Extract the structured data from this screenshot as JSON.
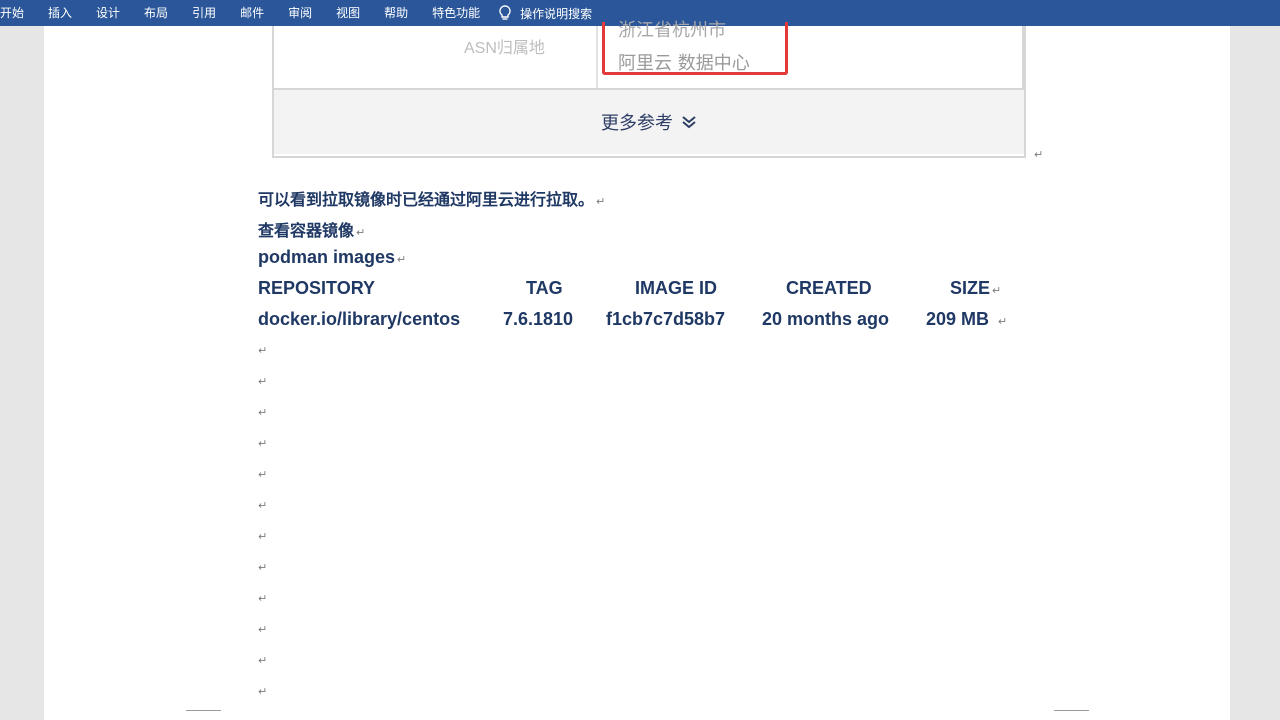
{
  "ribbon": {
    "tabs": [
      "开始",
      "插入",
      "设计",
      "布局",
      "引用",
      "邮件",
      "审阅",
      "视图",
      "帮助",
      "特色功能"
    ],
    "tell_me": "操作说明搜索"
  },
  "embed": {
    "asn_label": "ASN归属地",
    "highlight_line1": "浙江省杭州市",
    "highlight_line2": "阿里云 数据中心",
    "more_label": "更多参考"
  },
  "document": {
    "para1": "可以看到拉取镜像时已经通过阿里云进行拉取。",
    "para2": "查看容器镜像",
    "command": "podman images",
    "table_header": [
      "REPOSITORY",
      "TAG",
      "IMAGE ID",
      "CREATED",
      "SIZE"
    ],
    "table_row": [
      "docker.io/library/centos",
      "7.6.1810",
      "f1cb7c7d58b7",
      "20 months ago",
      "209 MB"
    ],
    "para_mark": "↵"
  }
}
